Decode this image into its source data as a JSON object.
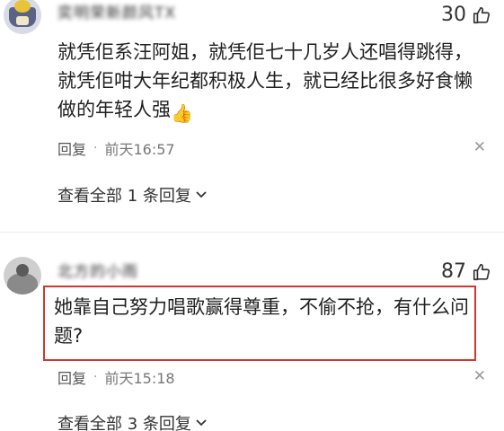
{
  "comments": [
    {
      "username": "奕明荣新颜风TX",
      "likes": "30",
      "text": "就凭佢系汪阿姐，就凭佢七十几岁人还唱得跳得，就凭佢咁大年纪都积极人生，就已经比很多好食懒做的年轻人强",
      "emoji": "👍",
      "reply_label": "回复",
      "time": "前天16:57",
      "view_replies": "查看全部 1 条回复"
    },
    {
      "username": "北方的小雨",
      "likes": "87",
      "text": "她靠自己努力唱歌赢得尊重，不偷不抢，有什么问题?",
      "reply_label": "回复",
      "time": "前天15:18",
      "view_replies": "查看全部 3 条回复"
    }
  ],
  "icons": {
    "like": "thumbs-up-icon",
    "more": "close-icon",
    "expand": "chevron-down-icon",
    "separator": "dot-icon"
  },
  "colors": {
    "highlight": "#d0382f"
  }
}
